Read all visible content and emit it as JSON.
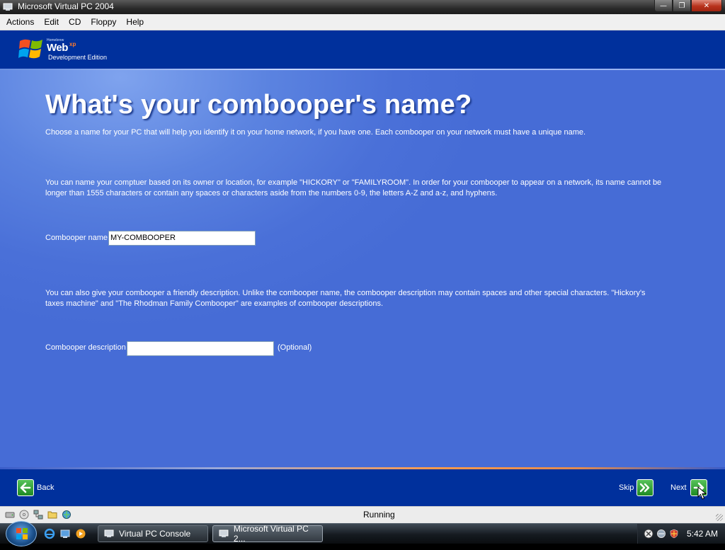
{
  "window": {
    "title": "Microsoft Virtual PC 2004",
    "min_glyph": "—",
    "max_glyph": "❐",
    "close_glyph": "✕"
  },
  "menubar": {
    "items": [
      "Actions",
      "Edit",
      "CD",
      "Floppy",
      "Help"
    ]
  },
  "vm": {
    "logo": {
      "small_text": "Homebrew",
      "web_text": "Web",
      "xp_text": "xp",
      "edition_text": "Development Edition"
    },
    "heading": "What's your combooper's name?",
    "paragraph1": "Choose a name for your PC that will help you identify it on your home network, if you have one. Each combooper on your network must have a unique name.",
    "paragraph2": "You can name your comptuer based on its owner or location, for example \"HICKORY\" or \"FAMILYROOM\". In order for your combooper to appear on a network, its name cannot be longer than 1555 characters or contain any spaces or characters aside from the numbers 0-9, the letters A-Z and a-z, and hyphens.",
    "name_label": "Combooper name",
    "name_value": "MY-COMBOOPER",
    "paragraph3": "You can also give your combooper a friendly description. Unlike the combooper name, the combooper description may contain spaces and other special characters. \"Hickory's taxes machine\" and \"The Rhodman Family Combooper\" are examples of combooper descriptions.",
    "description_label": "Combooper description",
    "description_value": "",
    "optional_text": "(Optional)",
    "back_label": "Back",
    "skip_label": "Skip",
    "next_label": "Next"
  },
  "statusbar": {
    "status": "Running",
    "icons": [
      "hard-disk-icon",
      "cd-icon",
      "network-icon",
      "folder-icon",
      "shared-folder-icon"
    ]
  },
  "taskbar": {
    "tasks": [
      {
        "label": "Virtual PC Console",
        "active": false
      },
      {
        "label": "Microsoft Virtual PC 2...",
        "active": true
      }
    ],
    "clock": "5:42 AM"
  },
  "colors": {
    "accent_green": "#2fa033",
    "header_blue": "#00309c",
    "content_blue": "#4a70d8"
  }
}
